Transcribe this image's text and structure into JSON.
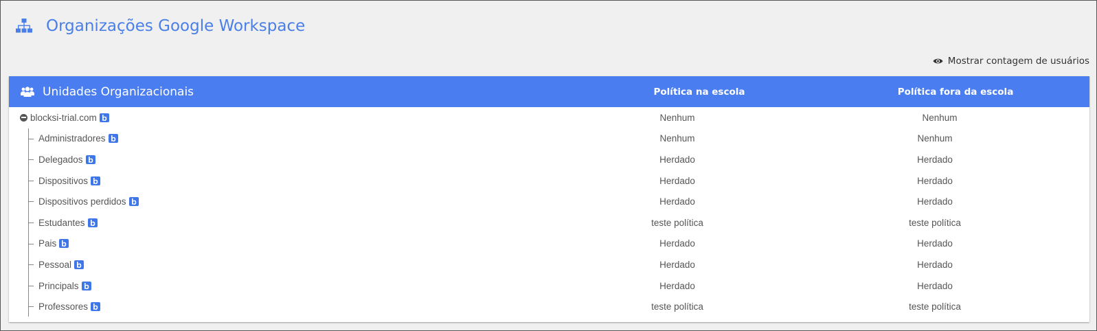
{
  "page": {
    "title": "Organizações Google Workspace",
    "accent_color": "#4a7fe8",
    "header_bar_color": "#4a7ef0"
  },
  "toolbar": {
    "show_user_count_label": "Mostrar contagem de usuários",
    "show_user_count_icon": "eye-icon"
  },
  "table": {
    "columns": {
      "units": "Unidades Organizacionais",
      "school_policy": "Política na escola",
      "outside_policy": "Política fora da escola"
    },
    "root": {
      "name": "blocksi-trial.com",
      "school_policy": "Nenhum",
      "outside_policy": "Nenhum",
      "expanded": true
    },
    "children": [
      {
        "name": "Administradores",
        "school_policy": "Nenhum",
        "outside_policy": "Nenhum"
      },
      {
        "name": "Delegados",
        "school_policy": "Herdado",
        "outside_policy": "Herdado"
      },
      {
        "name": "Dispositivos",
        "school_policy": "Herdado",
        "outside_policy": "Herdado"
      },
      {
        "name": "Dispositivos perdidos",
        "school_policy": "Herdado",
        "outside_policy": "Herdado"
      },
      {
        "name": "Estudantes",
        "school_policy": "teste política",
        "outside_policy": "teste política"
      },
      {
        "name": "Pais",
        "school_policy": "Herdado",
        "outside_policy": "Herdado"
      },
      {
        "name": "Pessoal",
        "school_policy": "Herdado",
        "outside_policy": "Herdado"
      },
      {
        "name": "Principals",
        "school_policy": "Herdado",
        "outside_policy": "Herdado"
      },
      {
        "name": "Professores",
        "school_policy": "teste política",
        "outside_policy": "teste política"
      }
    ]
  }
}
